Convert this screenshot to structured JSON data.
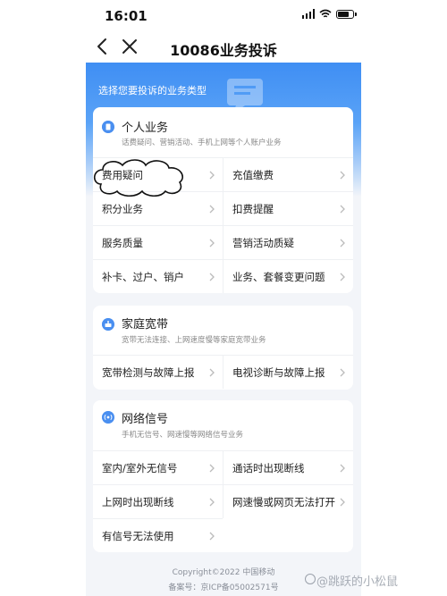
{
  "status_bar": {
    "time": "16:01"
  },
  "nav": {
    "title": "10086业务投诉"
  },
  "hero": {
    "prompt": "选择您要投诉的业务类型"
  },
  "categories": [
    {
      "title": "个人业务",
      "description": "话费疑问、营销活动、手机上网等个人账户业务",
      "items": [
        "费用疑问",
        "充值缴费",
        "积分业务",
        "扣费提醒",
        "服务质量",
        "营销活动质疑",
        "补卡、过户、销户",
        "业务、套餐变更问题"
      ]
    },
    {
      "title": "家庭宽带",
      "description": "宽带无法连接、上网速度慢等家庭宽带业务",
      "items": [
        "宽带检测与故障上报",
        "电视诊断与故障上报"
      ]
    },
    {
      "title": "网络信号",
      "description": "手机无信号、网速慢等网络信号业务",
      "items": [
        "室内/室外无信号",
        "通话时出现断线",
        "上网时出现断线",
        "网速慢或网页无法打开",
        "有信号无法使用"
      ]
    }
  ],
  "footer": {
    "copyright": "Copyright©2022 中国移动",
    "icp": "备案号：京ICP备05002571号"
  },
  "watermark": "@跳跃的小松鼠",
  "colors": {
    "accent": "#3f8ef3",
    "card_bg": "#ffffff",
    "page_bg": "#f3f5f9"
  }
}
